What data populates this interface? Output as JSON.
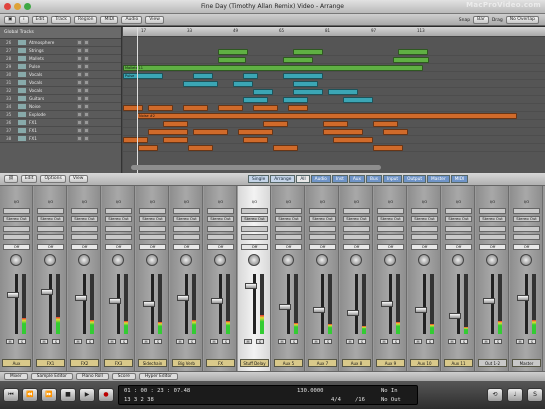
{
  "window": {
    "title": "Fine Day (Timothy Allan Remix) Video - Arrange",
    "watermark": "MacProVideo.com"
  },
  "toolbar": {
    "edit": "Edit",
    "track": "Track",
    "region": "Region",
    "midi": "MIDI",
    "audio": "Audio",
    "view": "View",
    "snap_label": "Snap",
    "snap_value": "Bar",
    "drag_label": "Drag",
    "drag_value": "No Overlap"
  },
  "arrange": {
    "global_tracks": "Global Tracks",
    "tracks": [
      {
        "num": "26",
        "name": "Atmosphere"
      },
      {
        "num": "27",
        "name": "Strings"
      },
      {
        "num": "28",
        "name": "Mallets"
      },
      {
        "num": "29",
        "name": "Pulse"
      },
      {
        "num": "30",
        "name": "Vocals"
      },
      {
        "num": "31",
        "name": "Vocals"
      },
      {
        "num": "32",
        "name": "Vocals"
      },
      {
        "num": "33",
        "name": "Guitars"
      },
      {
        "num": "34",
        "name": "Noise"
      },
      {
        "num": "35",
        "name": "Explode"
      },
      {
        "num": "36",
        "name": "FX1"
      },
      {
        "num": "37",
        "name": "FX1"
      },
      {
        "num": "38",
        "name": "FX1"
      }
    ],
    "ruler_ticks": [
      "17",
      "33",
      "49",
      "65",
      "81",
      "97",
      "113"
    ],
    "regions": {
      "mallets": "Mallets 11",
      "pulse": "Pulse",
      "noise": "Noise #2"
    }
  },
  "mixer": {
    "menus": {
      "edit": "Edit",
      "options": "Options",
      "view": "View"
    },
    "tabs": [
      "Single",
      "Arrange",
      "All",
      "Audio",
      "Inst",
      "Aux",
      "Bus",
      "Input",
      "Output",
      "Master",
      "MIDI"
    ],
    "strips": [
      {
        "name": "Aux"
      },
      {
        "name": "FX1"
      },
      {
        "name": "FX2"
      },
      {
        "name": "FX3"
      },
      {
        "name": "Sidechain"
      },
      {
        "name": "Big Verb"
      },
      {
        "name": "FX"
      },
      {
        "name": "Stuff Delay"
      },
      {
        "name": "Aux 5"
      },
      {
        "name": "Aux 7"
      },
      {
        "name": "Aux 8"
      },
      {
        "name": "Aux 9"
      },
      {
        "name": "Aux 10"
      },
      {
        "name": "Aux 11"
      },
      {
        "name": "Out 1-2"
      },
      {
        "name": "Master"
      }
    ],
    "labels": {
      "io": "I/O",
      "stereo_out": "Stereo Out",
      "off": "Off",
      "m": "M",
      "s": "S"
    }
  },
  "bottom_tabs": [
    "Mixer",
    "Sample Editor",
    "Piano Roll",
    "Score",
    "Hyper Editor"
  ],
  "transport": {
    "smpte": "01 : 00 : 23 : 07.48",
    "bar_position": "13   3   2   38",
    "sig": "4/4",
    "tempo": "130.0000",
    "division": "/16",
    "in_label": "No In",
    "out_label": "No Out"
  },
  "colors": {
    "region_green": "#5fb043",
    "region_cyan": "#3ba6b5",
    "region_orange": "#d06a2a",
    "chan_label": "#d9c98a"
  }
}
